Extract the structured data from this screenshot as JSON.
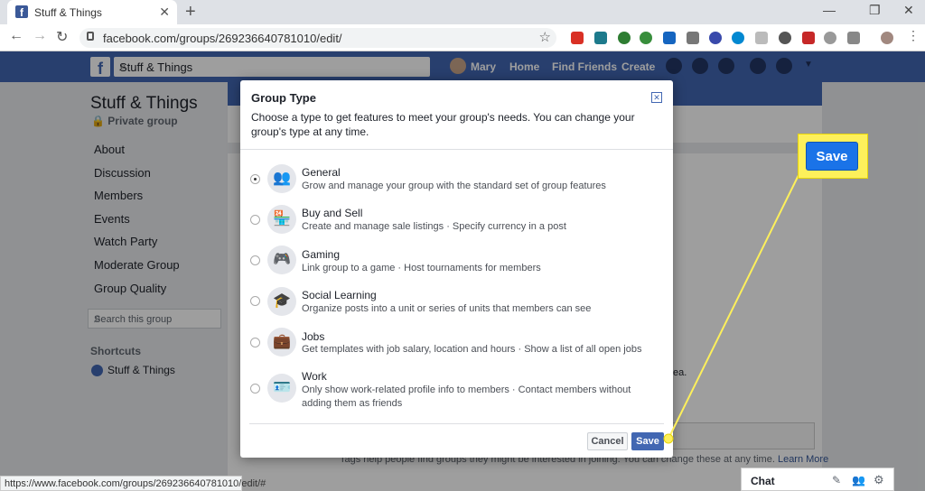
{
  "browser": {
    "tab_title": "Stuff & Things",
    "tab_close": "✕",
    "new_tab": "+",
    "url": "facebook.com/groups/269236640781010/edit/",
    "window_min": "—",
    "window_max": "❐",
    "window_close": "✕",
    "status_url": "https://www.facebook.com/groups/269236640781010/edit/#"
  },
  "fb": {
    "search_value": "Stuff & Things",
    "user": "Mary",
    "home": "Home",
    "find_friends": "Find Friends",
    "create": "Create"
  },
  "sidebar": {
    "group_name": "Stuff & Things",
    "privacy": "Private group",
    "items": [
      "About",
      "Discussion",
      "Members",
      "Events",
      "Watch Party",
      "Moderate Group",
      "Group Quality"
    ],
    "search_placeholder": "Search this group",
    "shortcuts_heading": "Shortcuts",
    "shortcut_item": "Stuff & Things"
  },
  "background": {
    "tags_text": "Tags help people find groups they might be interested in joining. You can change these at any time.",
    "learn_more": "Learn More",
    "partial_text": "ea."
  },
  "dialog": {
    "title": "Group Type",
    "description": "Choose a type to get features to meet your group's needs. You can change your group's type at any time.",
    "options": [
      {
        "title": "General",
        "desc": "Grow and manage your group with the standard set of group features",
        "icon": "people-icon",
        "selected": true
      },
      {
        "title": "Buy and Sell",
        "desc": "Create and manage sale listings · Specify currency in a post",
        "icon": "shop-icon",
        "selected": false
      },
      {
        "title": "Gaming",
        "desc": "Link group to a game · Host tournaments for members",
        "icon": "gamepad-icon",
        "selected": false
      },
      {
        "title": "Social Learning",
        "desc": "Organize posts into a unit or series of units that members can see",
        "icon": "graduation-cap-icon",
        "selected": false
      },
      {
        "title": "Jobs",
        "desc": "Get templates with job salary, location and hours · Show a list of all open jobs",
        "icon": "briefcase-icon",
        "selected": false
      },
      {
        "title": "Work",
        "desc": "Only show work-related profile info to members · Contact members without adding them as friends",
        "icon": "badge-icon",
        "selected": false
      }
    ],
    "cancel_label": "Cancel",
    "save_label": "Save"
  },
  "callout": {
    "save_label": "Save",
    "color": "#fdf05b"
  },
  "chat": {
    "label": "Chat"
  },
  "colors": {
    "fb_blue": "#4267b2",
    "highlight_yellow": "#fdf05b"
  }
}
